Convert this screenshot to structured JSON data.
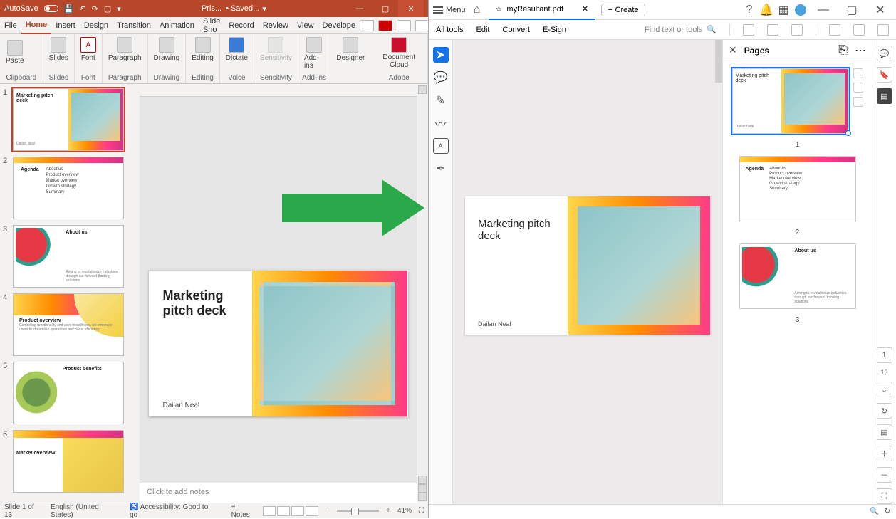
{
  "powerpoint": {
    "titlebar": {
      "autosave": "AutoSave",
      "doc": "Pris...",
      "status": "• Saved..."
    },
    "tabs": [
      "File",
      "Home",
      "Insert",
      "Design",
      "Transition",
      "Animation",
      "Slide Sho",
      "Record",
      "Review",
      "View",
      "Develope"
    ],
    "active_tab": "Home",
    "groups": {
      "clipboard": {
        "paste": "Paste",
        "label": "Clipboard"
      },
      "slides": {
        "btn": "Slides",
        "label": "Slides"
      },
      "font": {
        "btn": "Font",
        "label": "Font"
      },
      "paragraph": {
        "btn": "Paragraph",
        "label": "Paragraph"
      },
      "drawing": {
        "btn": "Drawing",
        "label": "Drawing"
      },
      "editing": {
        "btn": "Editing",
        "label": "Editing"
      },
      "voice": {
        "btn": "Dictate",
        "label": "Voice"
      },
      "sensitivity": {
        "btn": "Sensitivity",
        "label": "Sensitivity"
      },
      "addins": {
        "btn": "Add-ins",
        "label": "Add-ins"
      },
      "designer": {
        "btn": "Designer"
      },
      "adobe": {
        "btn": "Document Cloud",
        "label": "Adobe"
      }
    },
    "slide": {
      "title": "Marketing pitch deck",
      "author": "Dailan Neal"
    },
    "thumbs": [
      {
        "n": "1",
        "title": "Marketing pitch deck",
        "author": "Dailan Neal"
      },
      {
        "n": "2",
        "title": "Agenda",
        "items": [
          "About us",
          "Product overview",
          "Market overview",
          "Growth strategy",
          "Summary"
        ]
      },
      {
        "n": "3",
        "title": "About us",
        "desc": "Aiming to revolutionize industries through our forward-thinking solutions"
      },
      {
        "n": "4",
        "title": "Product overview",
        "desc": "Combining functionality and user-friendliness, we empower users to streamline operations and boost efficiency"
      },
      {
        "n": "5",
        "title": "Product benefits"
      },
      {
        "n": "6",
        "title": "Market overview"
      }
    ],
    "notes_placeholder": "Click to add notes",
    "status": {
      "slide": "Slide 1 of 13",
      "lang": "English (United States)",
      "accessibility": "Accessibility: Good to go",
      "notes": "Notes",
      "zoom": "41%"
    }
  },
  "acrobat": {
    "menu": "Menu",
    "tab": "myResultant.pdf",
    "create": "Create",
    "toolbar": {
      "all": "All tools",
      "edit": "Edit",
      "convert": "Convert",
      "esign": "E-Sign",
      "find": "Find text or tools"
    },
    "pages_panel": {
      "title": "Pages"
    },
    "page": {
      "title": "Marketing pitch deck",
      "author": "Dailan Neal"
    },
    "thumbs": [
      {
        "n": "1",
        "title": "Marketing pitch deck",
        "author": "Dailan Neal"
      },
      {
        "n": "2",
        "title": "Agenda",
        "items": [
          "About us",
          "Product overview",
          "Market overview",
          "Growth strategy",
          "Summary"
        ]
      },
      {
        "n": "3",
        "title": "About us",
        "desc": "Aiming to revolutionize industries through our forward-thinking solutions"
      }
    ],
    "rail": {
      "page_num": "1",
      "count": "13"
    }
  }
}
